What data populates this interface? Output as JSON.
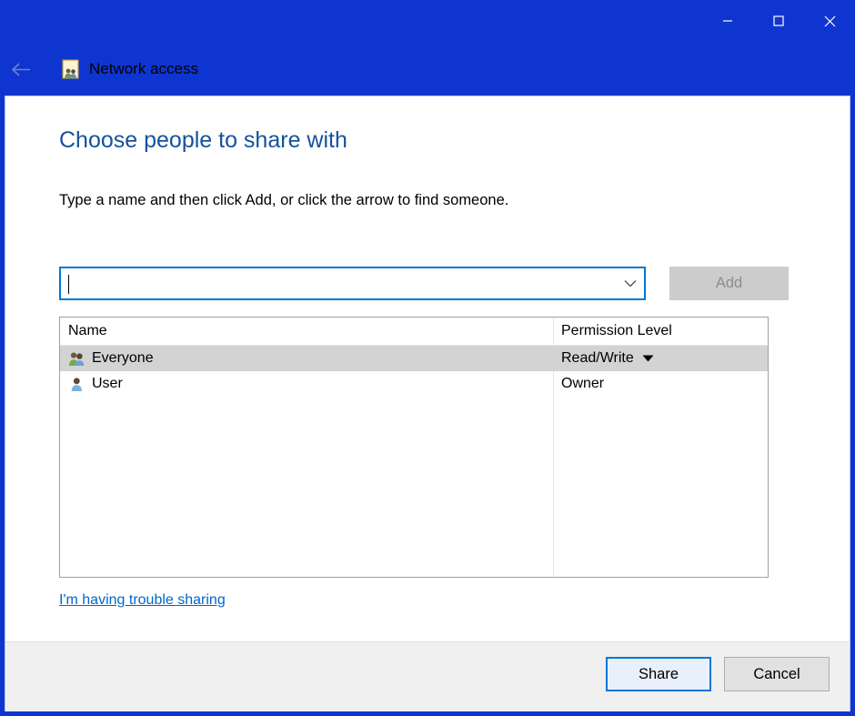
{
  "window": {
    "title": "Network access",
    "title_icon": "network-share-people-icon",
    "back_icon": "back-arrow-icon",
    "caption": {
      "minimize": "minimize-icon",
      "maximize": "maximize-icon",
      "close": "close-icon"
    },
    "accent_color": "#0f35d0"
  },
  "page": {
    "heading": "Choose people to share with",
    "heading_color": "#14529e",
    "instruction": "Type a name and then click Add, or click the arrow to find someone."
  },
  "entry": {
    "value": "",
    "placeholder": "",
    "dropdown_icon": "chevron-down-icon",
    "add_label": "Add",
    "add_enabled": false
  },
  "list": {
    "columns": [
      "Name",
      "Permission Level"
    ],
    "rows": [
      {
        "name": "Everyone",
        "icon": "group-users-icon",
        "permission": "Read/Write",
        "permission_has_dropdown": true,
        "selected": true
      },
      {
        "name": "User",
        "icon": "single-user-icon",
        "permission": "Owner",
        "permission_has_dropdown": false,
        "selected": false
      }
    ]
  },
  "links": {
    "trouble": "I'm having trouble sharing",
    "link_color": "#0066cc"
  },
  "footer": {
    "share_label": "Share",
    "cancel_label": "Cancel",
    "default_button": "Share"
  }
}
